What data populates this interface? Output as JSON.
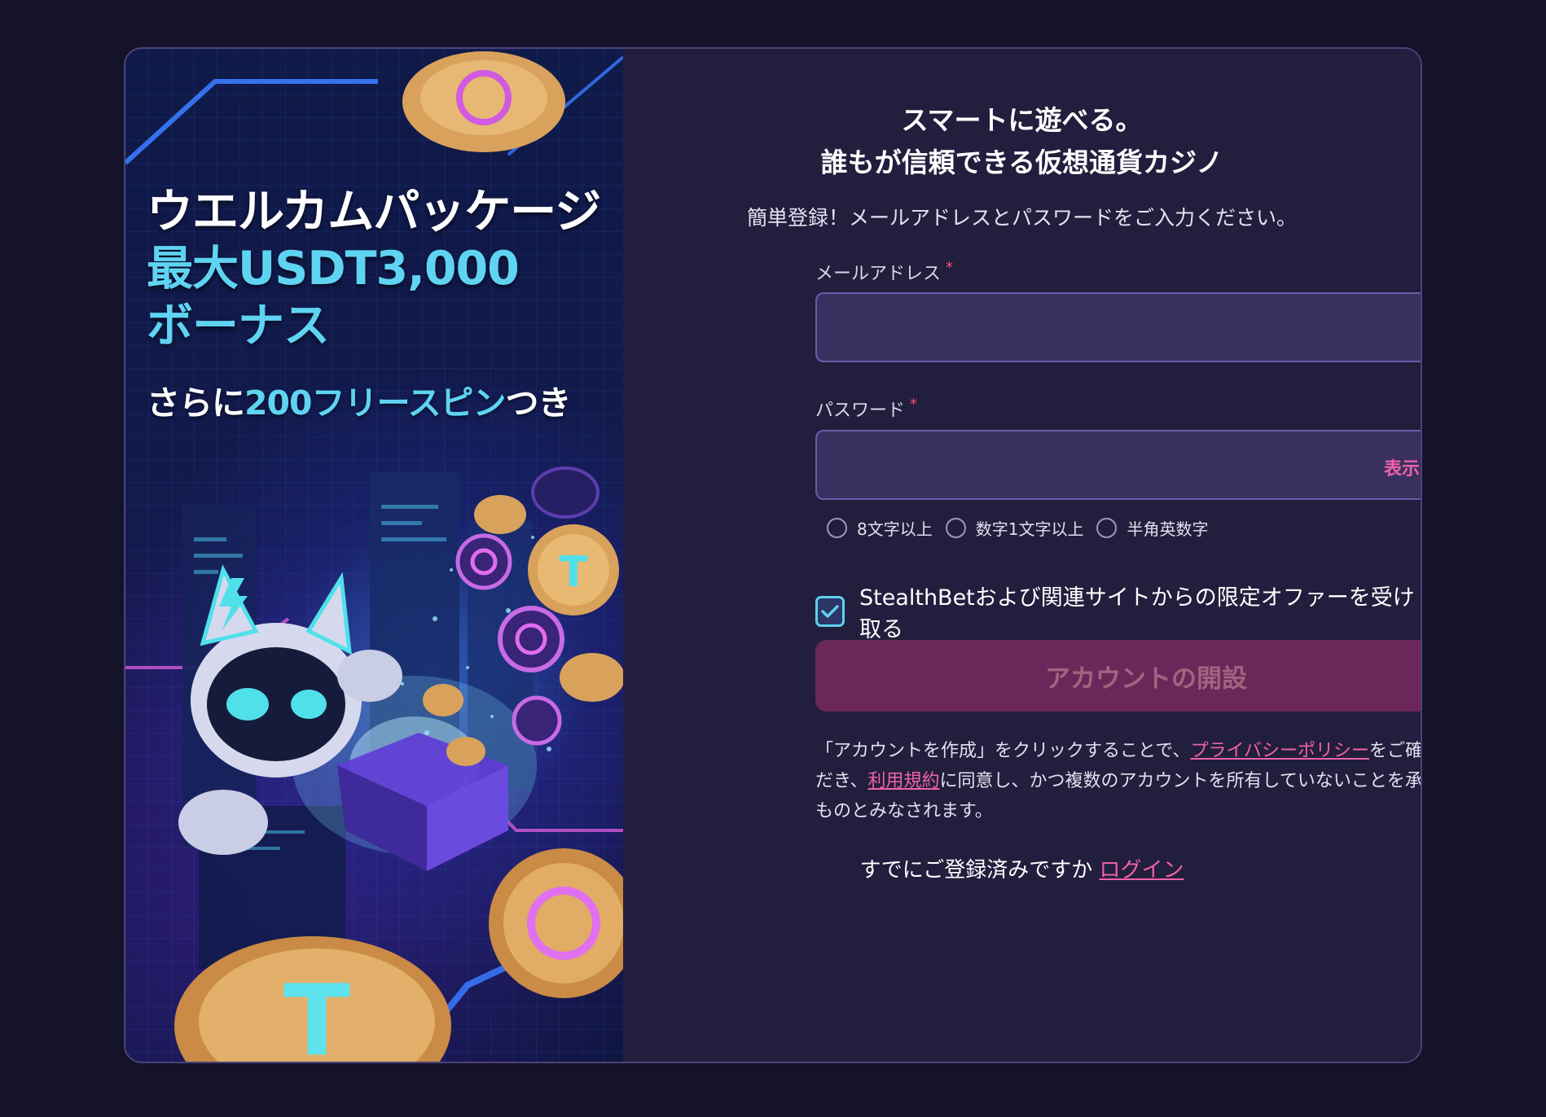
{
  "promo": {
    "title": "ウエルカムパッケージ",
    "amount": "最大USDT3,000",
    "bonus": "ボーナス",
    "spins_prefix": "さらに",
    "spins_highlight": "200フリースピン",
    "spins_suffix": "つき"
  },
  "form": {
    "heading_line1": "スマートに遊べる。",
    "heading_line2": "誰もが信頼できる仮想通貨カジノ",
    "subtext": "簡単登録！メールアドレスとパスワードをご入力ください。",
    "email_label": "メールアドレス",
    "email_value": "",
    "password_label": "パスワード",
    "password_value": "",
    "required_mark": "*",
    "show_password": "表示する",
    "rules": [
      "8文字以上",
      "数字1文字以上",
      "半角英数字"
    ],
    "optin_checked": true,
    "optin_label": "StealthBetおよび関連サイトからの限定オファーを受け取る",
    "submit_label": "アカウントの開設",
    "legal_part1": "「アカウントを作成」をクリックすることで、",
    "legal_privacy_link": "プライバシーポリシー",
    "legal_part2": "をご確認いただき、",
    "legal_terms_link": "利用規約",
    "legal_part3": "に同意し、かつ複数のアカウントを所有していないことを承認したものとみなされます。",
    "login_prompt": "すでにご登録済みですか",
    "login_link": "ログイン"
  },
  "colors": {
    "page_bg": "#14132a",
    "panel_bg": "#221e3d",
    "input_bg": "#3a3060",
    "accent_pink": "#ef62a8",
    "accent_cyan": "#5fd4f2",
    "button_bg": "#6b2759"
  }
}
